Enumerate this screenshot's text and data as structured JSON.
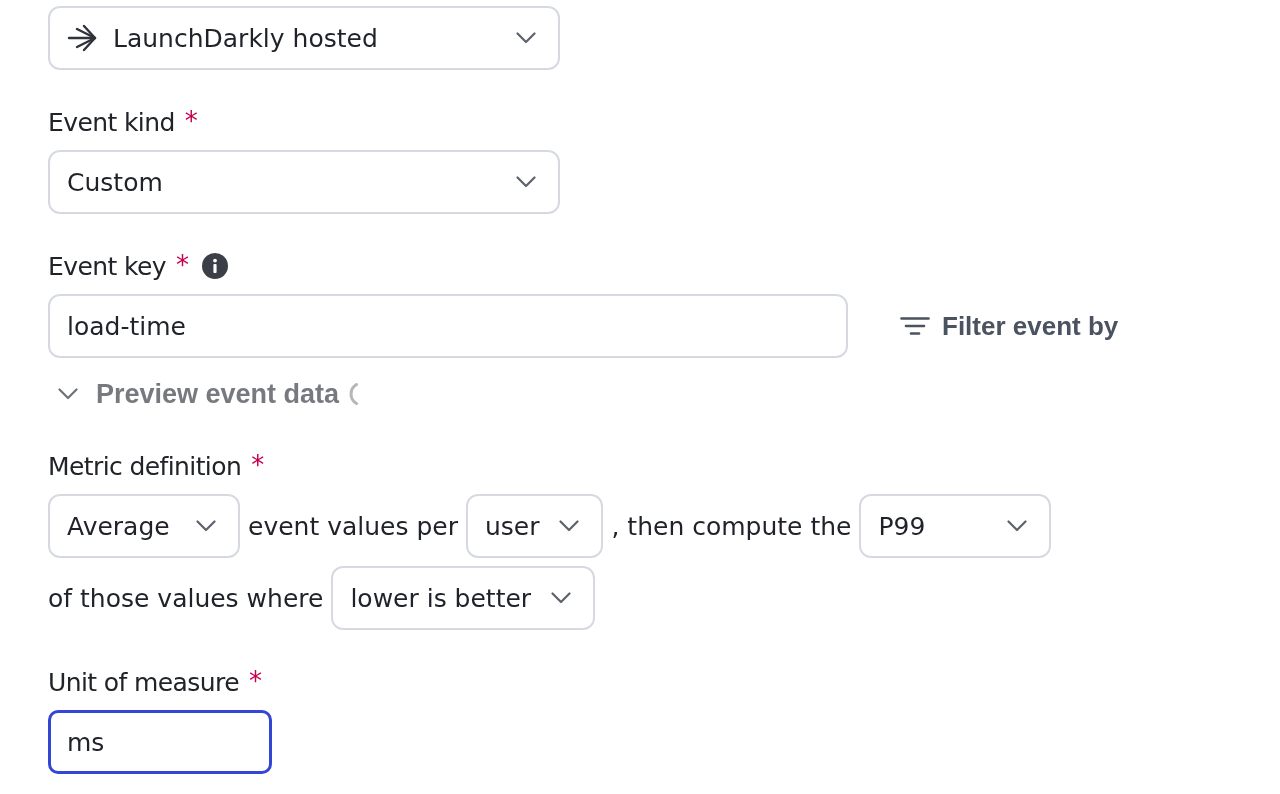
{
  "source_select": {
    "value": "LaunchDarkly hosted"
  },
  "event_kind": {
    "label": "Event kind",
    "required_mark": "*",
    "value": "Custom"
  },
  "event_key": {
    "label": "Event key",
    "required_mark": "*",
    "value": "load-time"
  },
  "filter_button": {
    "label": "Filter event by"
  },
  "preview": {
    "label": "Preview event data",
    "loading": true
  },
  "metric_definition": {
    "label": "Metric definition",
    "required_mark": "*",
    "parts": [
      {
        "kind": "select",
        "value": "Average"
      },
      {
        "kind": "text",
        "text": "event values per"
      },
      {
        "kind": "select",
        "value": "user"
      },
      {
        "kind": "text",
        "text": ", then compute the"
      },
      {
        "kind": "select",
        "value": "P99"
      },
      {
        "kind": "text",
        "text": "of those values where"
      },
      {
        "kind": "select",
        "value": "lower is better"
      }
    ]
  },
  "unit_of_measure": {
    "label": "Unit of measure",
    "required_mark": "*",
    "value": "ms",
    "focused": true
  }
}
